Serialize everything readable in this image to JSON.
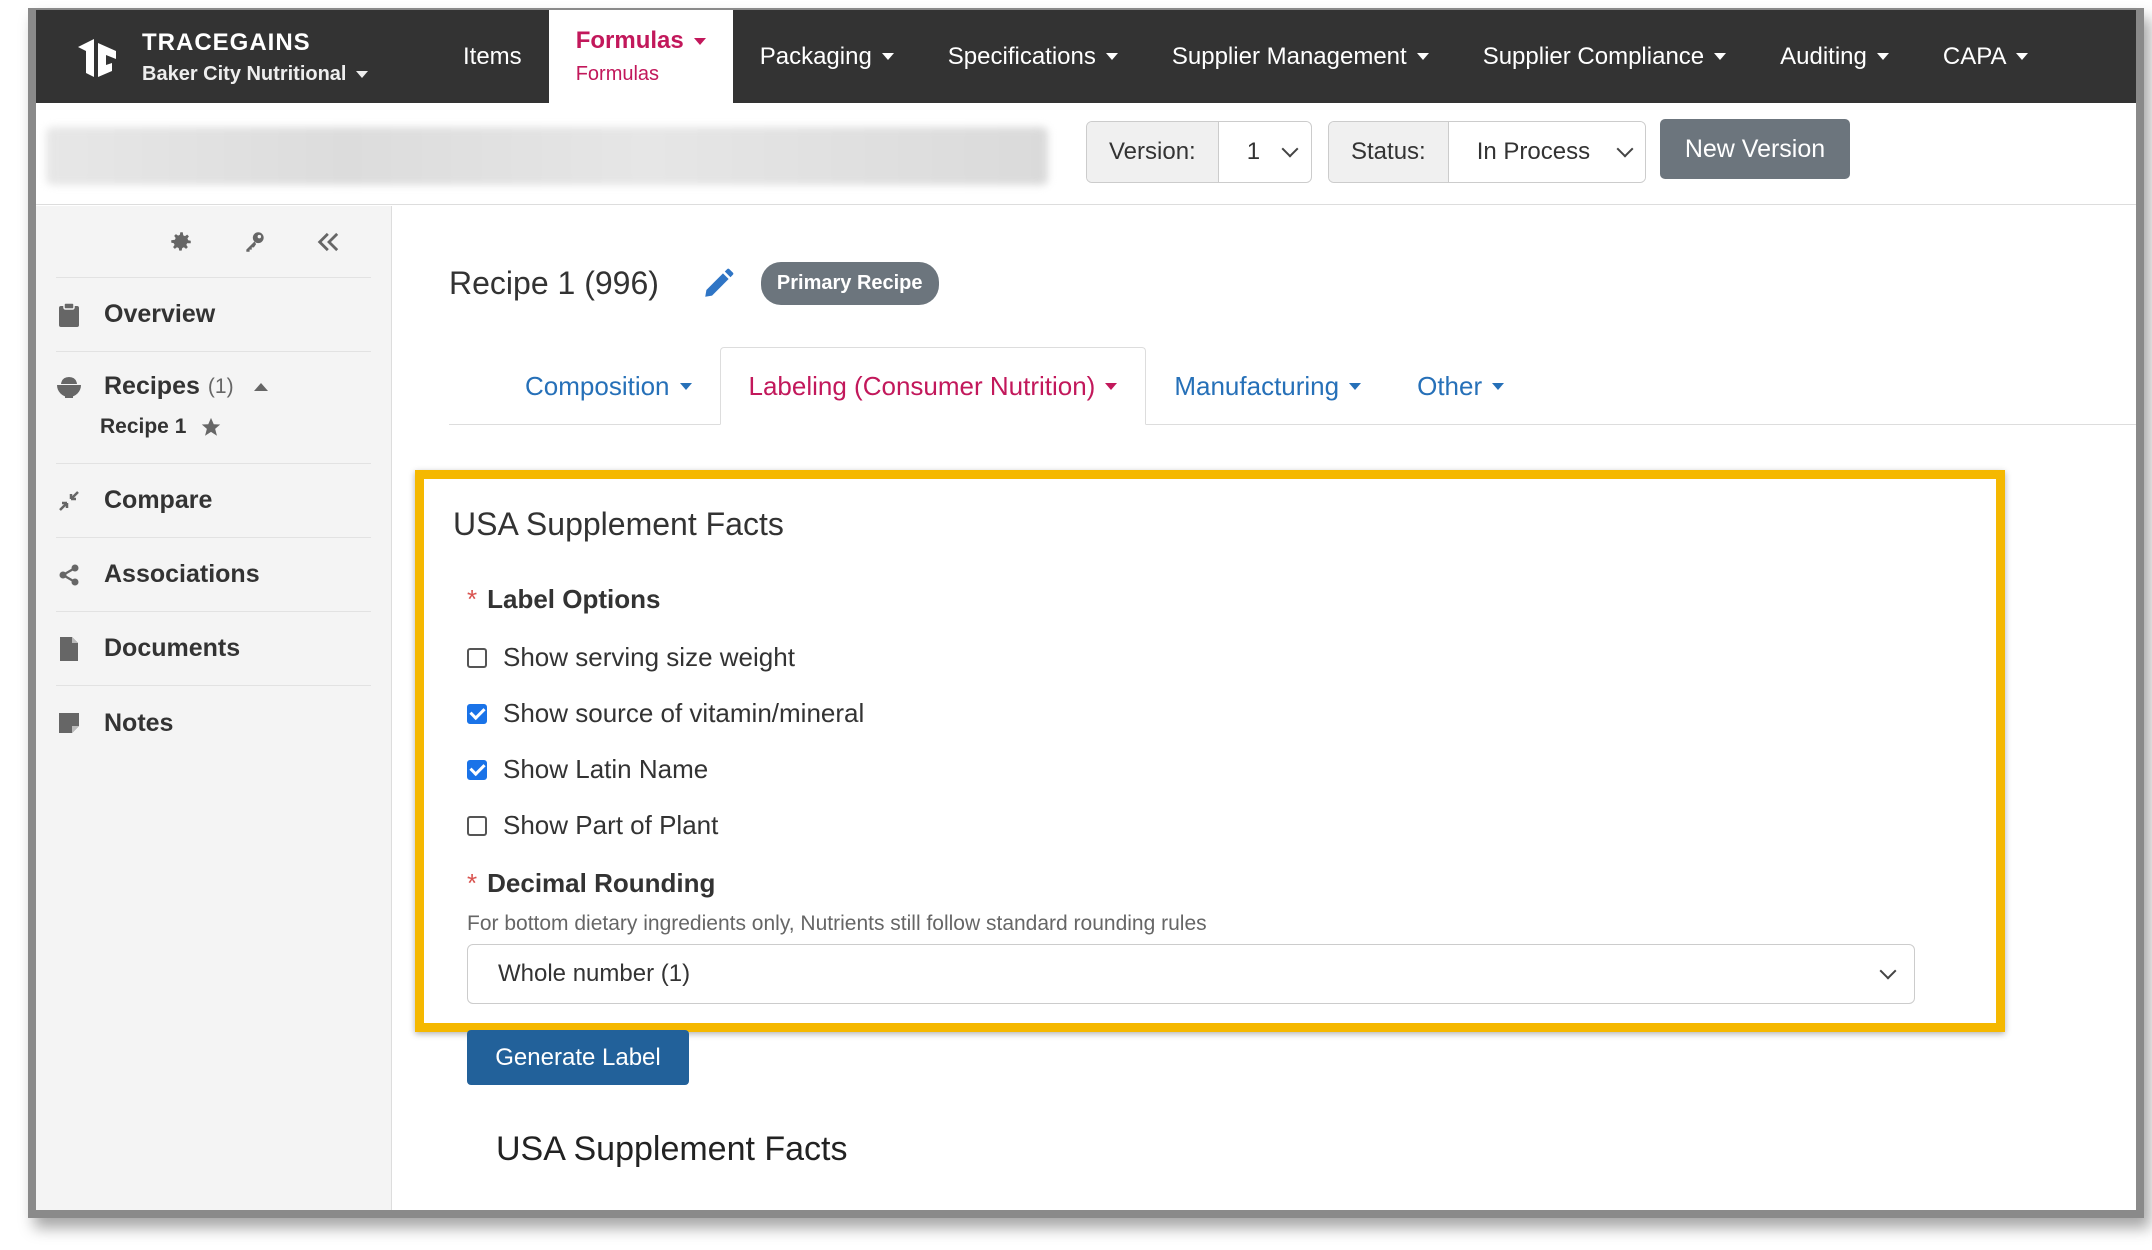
{
  "brand": {
    "name": "TRACEGAINS",
    "org": "Baker City Nutritional"
  },
  "nav": {
    "items": [
      "Items"
    ],
    "formulas": {
      "main": "Formulas",
      "sub": "Formulas"
    },
    "menus": [
      "Packaging",
      "Specifications",
      "Supplier Management",
      "Supplier Compliance",
      "Auditing",
      "CAPA"
    ]
  },
  "versionbar": {
    "version_label": "Version:",
    "version_value": "1",
    "status_label": "Status:",
    "status_value": "In Process",
    "new_version_button": "New Version"
  },
  "sidebar": {
    "overview": "Overview",
    "recipes": "Recipes",
    "recipes_count": "(1)",
    "recipe_item": "Recipe 1",
    "compare": "Compare",
    "associations": "Associations",
    "documents": "Documents",
    "notes": "Notes"
  },
  "recipe": {
    "title": "Recipe 1 (996)",
    "badge": "Primary Recipe"
  },
  "tabs": [
    "Composition",
    "Labeling (Consumer Nutrition)",
    "Manufacturing",
    "Other"
  ],
  "form": {
    "section_title": "USA Supplement Facts",
    "label_options": "Label Options",
    "options": [
      {
        "label": "Show serving size weight",
        "checked": false
      },
      {
        "label": "Show source of vitamin/mineral",
        "checked": true
      },
      {
        "label": "Show Latin Name",
        "checked": true
      },
      {
        "label": "Show Part of Plant",
        "checked": false
      }
    ],
    "decimal_rounding": "Decimal Rounding",
    "help": "For bottom dietary ingredients only, Nutrients still follow standard rounding rules",
    "rounding_value": "Whole number (1)",
    "generate_button": "Generate Label",
    "bottom_title": "USA Supplement Facts"
  },
  "colors": {
    "nav_bg": "#333333",
    "accent_pink": "#c2185b",
    "link_blue": "#2670b8",
    "highlight": "#f5b800",
    "primary_button": "#22619a"
  }
}
